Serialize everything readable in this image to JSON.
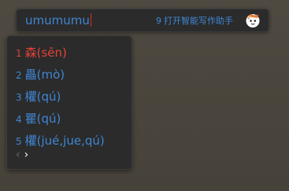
{
  "ime": {
    "composition": "umumumu",
    "ai_hint": {
      "index": "9",
      "label": "打开智能写作助手"
    },
    "mascot_icon": "ime-mascot-icon",
    "candidates": [
      {
        "index": "1",
        "text": "森(sēn)",
        "selected": true
      },
      {
        "index": "2",
        "text": "畾(mò)",
        "selected": false
      },
      {
        "index": "3",
        "text": "欋(qú)",
        "selected": false
      },
      {
        "index": "4",
        "text": "瞿(qú)",
        "selected": false
      },
      {
        "index": "5",
        "text": "欋(jué,jue,qú)",
        "selected": false
      }
    ],
    "pager": {
      "prev": "‹",
      "next": "›"
    }
  },
  "colors": {
    "candidate_text": "#3f86d4",
    "selected_text": "#e5423a",
    "panel_bg": "#2b2b2b",
    "caret": "#d92b2b"
  }
}
